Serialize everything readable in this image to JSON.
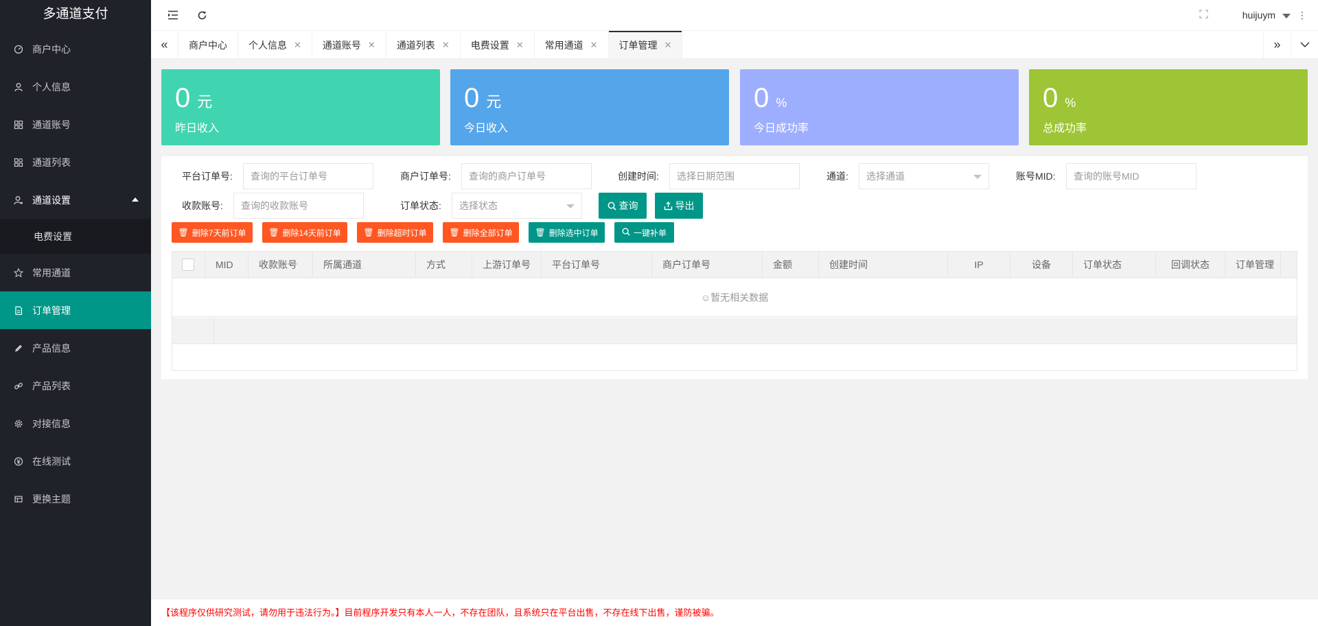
{
  "app": {
    "title": "多通道支付"
  },
  "sidebar": {
    "items": [
      {
        "label": "商户中心",
        "icon": "dashboard-icon"
      },
      {
        "label": "个人信息",
        "icon": "user-icon"
      },
      {
        "label": "通道账号",
        "icon": "grid-icon"
      },
      {
        "label": "通道列表",
        "icon": "apps-icon"
      },
      {
        "label": "通道设置",
        "icon": "user-settings-icon"
      },
      {
        "label": "常用通道",
        "icon": "star-icon"
      },
      {
        "label": "订单管理",
        "icon": "document-icon"
      },
      {
        "label": "产品信息",
        "icon": "pencil-icon"
      },
      {
        "label": "产品列表",
        "icon": "link-icon"
      },
      {
        "label": "对接信息",
        "icon": "gear-icon"
      },
      {
        "label": "在线测试",
        "icon": "yen-icon"
      },
      {
        "label": "更换主题",
        "icon": "theme-icon"
      }
    ],
    "sub_items": [
      {
        "label": "电费设置"
      }
    ]
  },
  "header": {
    "username": "huijuym"
  },
  "tabs": [
    {
      "label": "商户中心"
    },
    {
      "label": "个人信息"
    },
    {
      "label": "通道账号"
    },
    {
      "label": "通道列表"
    },
    {
      "label": "电费设置"
    },
    {
      "label": "常用通道"
    },
    {
      "label": "订单管理"
    }
  ],
  "stats": [
    {
      "value": "0",
      "unit": "元",
      "label": "昨日收入",
      "color": "#40d4b0"
    },
    {
      "value": "0",
      "unit": "元",
      "label": "今日收入",
      "color": "#55a5ea"
    },
    {
      "value": "0",
      "unit": "%",
      "label": "今日成功率",
      "color": "#9eaefe"
    },
    {
      "value": "0",
      "unit": "%",
      "label": "总成功率",
      "color": "#9dc535"
    }
  ],
  "filters": {
    "platform_order": {
      "label": "平台订单号:",
      "placeholder": "查询的平台订单号"
    },
    "merchant_order": {
      "label": "商户订单号:",
      "placeholder": "查询的商户订单号"
    },
    "created_time": {
      "label": "创建时间:",
      "placeholder": "选择日期范围"
    },
    "channel": {
      "label": "通道:",
      "placeholder": "选择通道"
    },
    "account_mid": {
      "label": "账号MID:",
      "placeholder": "查询的账号MID"
    },
    "receive_account": {
      "label": "收款账号:",
      "placeholder": "查询的收款账号"
    },
    "order_status": {
      "label": "订单状态:",
      "placeholder": "选择状态"
    },
    "search_label": "查询",
    "export_label": "导出"
  },
  "actions": [
    {
      "label": "删除7天前订单"
    },
    {
      "label": "删除14天前订单"
    },
    {
      "label": "删除超时订单"
    },
    {
      "label": "删除全部订单"
    },
    {
      "label": "删除选中订单"
    },
    {
      "label": "一键补单"
    }
  ],
  "table": {
    "columns": [
      "MID",
      "收款账号",
      "所属通道",
      "方式",
      "上游订单号",
      "平台订单号",
      "商户订单号",
      "金额",
      "创建时间",
      "IP",
      "设备",
      "订单状态",
      "回调状态",
      "订单管理"
    ],
    "empty_text": "☺暂无相关数据"
  },
  "footer": {
    "notice": "【该程序仅供研究测试，请勿用于违法行为。】目前程序开发只有本人一人，不存在团队，且系统只在平台出售，不存在线下出售，谨防被骗。"
  }
}
